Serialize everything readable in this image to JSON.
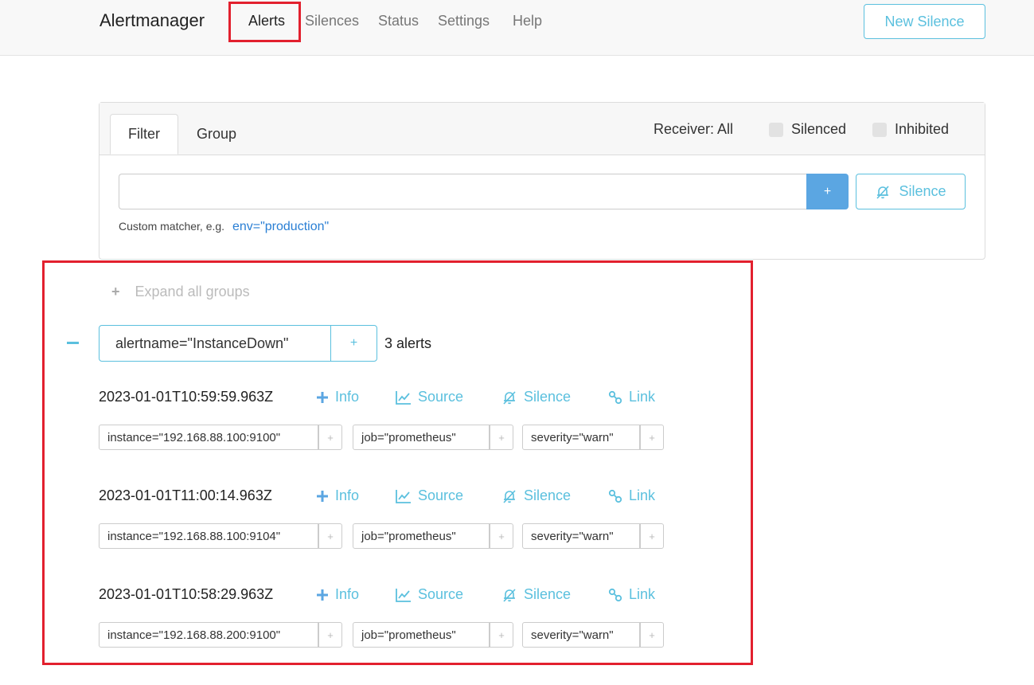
{
  "nav": {
    "brand": "Alertmanager",
    "items": [
      "Alerts",
      "Silences",
      "Status",
      "Settings",
      "Help"
    ],
    "new_silence": "New Silence"
  },
  "filter_card": {
    "tabs": [
      "Filter",
      "Group"
    ],
    "receiver": "Receiver: All",
    "silenced": "Silenced",
    "inhibited": "Inhibited",
    "input_value": "",
    "add_button": "+",
    "silence_button": "Silence",
    "hint_prefix": "Custom matcher, e.g.",
    "hint_example": "env=\"production\""
  },
  "groups_panel": {
    "expand_all_icon": "+",
    "expand_all": "Expand all groups",
    "group": {
      "label": "alertname=\"InstanceDown\"",
      "add": "+",
      "count": "3 alerts"
    },
    "actions": {
      "info": "Info",
      "source": "Source",
      "silence": "Silence",
      "link": "Link",
      "label_add": "+"
    },
    "alerts": [
      {
        "timestamp": "2023-01-01T10:59:59.963Z",
        "labels": [
          "instance=\"192.168.88.100:9100\"",
          "job=\"prometheus\"",
          "severity=\"warn\""
        ]
      },
      {
        "timestamp": "2023-01-01T11:00:14.963Z",
        "labels": [
          "instance=\"192.168.88.100:9104\"",
          "job=\"prometheus\"",
          "severity=\"warn\""
        ]
      },
      {
        "timestamp": "2023-01-01T10:58:29.963Z",
        "labels": [
          "instance=\"192.168.88.200:9100\"",
          "job=\"prometheus\"",
          "severity=\"warn\""
        ]
      }
    ]
  },
  "colors": {
    "accent": "#5bc0de",
    "primary": "#5ba6e2",
    "highlight": "#e2202e"
  }
}
